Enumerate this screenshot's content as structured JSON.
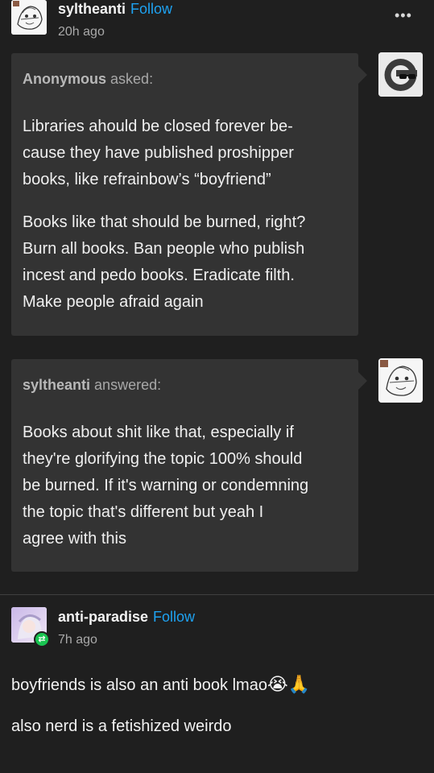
{
  "post1": {
    "username": "syltheanti",
    "follow": "Follow",
    "time": "20h ago",
    "more": "•••"
  },
  "ask": {
    "asker_name": "Anonymous",
    "asker_suffix": "asked:",
    "para1": [
      "Libraries ahould be closed forever be-",
      "cause they have published proshipper",
      "books, like refrainbow’s “boyfriend”"
    ],
    "para2": [
      "Books like that should be burned, right?",
      "Burn all books. Ban people who publish",
      "incest and pedo books. Eradicate filth.",
      "Make people afraid again"
    ]
  },
  "answer": {
    "answerer_name": "syltheanti",
    "answerer_suffix": "answered:",
    "lines": [
      "Books about shit like that, especially if",
      "they're glorifying the topic 100% should",
      "be burned. If it's warning or condemning",
      "the topic that's different but yeah I",
      "agree with this"
    ]
  },
  "post2": {
    "username": "anti-paradise",
    "follow": "Follow",
    "time": "7h ago",
    "line1": "boyfriends is also an anti book lmao",
    "line1_emoji": "😭🙏",
    "line2": "also nerd is a fetishized weirdo",
    "reblog_icon": "reblog-icon"
  },
  "colors": {
    "background": "#1f1f1f",
    "bubble": "#333333",
    "follow": "#1ea2f1",
    "reblog": "#19c451"
  }
}
